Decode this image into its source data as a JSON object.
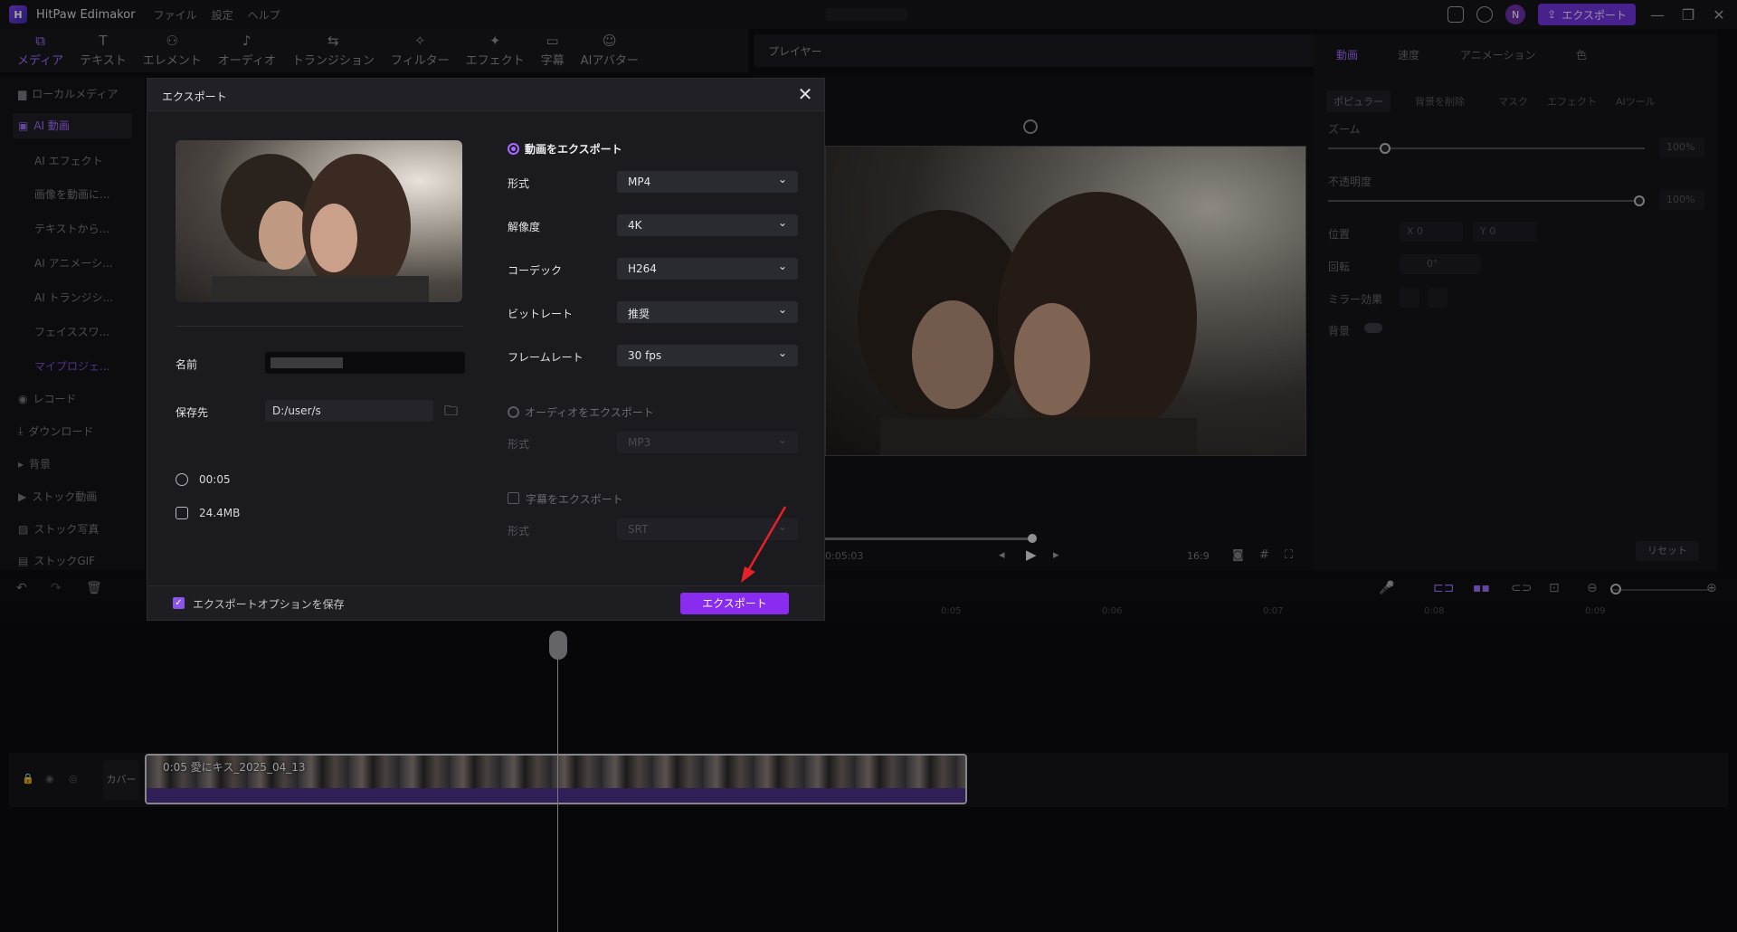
{
  "titlebar": {
    "app_name": "HitPaw Edimakor",
    "menu": [
      "ファイル",
      "設定",
      "ヘルプ"
    ],
    "avatar_letter": "N",
    "export_label": "エクスポート"
  },
  "toolbar": {
    "tools": [
      {
        "label": "メディア",
        "icon": "⧉"
      },
      {
        "label": "テキスト",
        "icon": "T"
      },
      {
        "label": "エレメント",
        "icon": "⚇"
      },
      {
        "label": "オーディオ",
        "icon": "♪"
      },
      {
        "label": "トランジション",
        "icon": "⇆"
      },
      {
        "label": "フィルター",
        "icon": "✧"
      },
      {
        "label": "エフェクト",
        "icon": "✦"
      },
      {
        "label": "字幕",
        "icon": "▭"
      },
      {
        "label": "AIアバター",
        "icon": "☺"
      }
    ]
  },
  "player": {
    "title": "プレイヤー",
    "timecode": "0:05:03",
    "aspect": "16:9"
  },
  "sidebar": {
    "items": [
      {
        "label": "ローカルメディア"
      },
      {
        "label": "AI 動画"
      },
      {
        "label": "AI エフェクト"
      },
      {
        "label": "画像を動画に..."
      },
      {
        "label": "テキストから..."
      },
      {
        "label": "AI アニメーシ..."
      },
      {
        "label": "AI トランジシ..."
      },
      {
        "label": "フェイススワ..."
      },
      {
        "label": "マイプロジェ..."
      },
      {
        "label": "レコード"
      },
      {
        "label": "ダウンロード"
      },
      {
        "label": "背景"
      },
      {
        "label": "ストック動画"
      },
      {
        "label": "ストック写真"
      },
      {
        "label": "ストックGIF"
      }
    ]
  },
  "right_panel": {
    "tabs": [
      "動画",
      "速度",
      "アニメーション",
      "色"
    ],
    "subtabs": [
      "ポピュラー",
      "背景を削除",
      "マスク",
      "エフェクト",
      "AIツール"
    ],
    "zoom_label": "ズーム",
    "zoom_value": "100%",
    "zoom_level": 0.17,
    "opacity_label": "不透明度",
    "opacity_value": "100%",
    "opacity_level": 1.0,
    "position_label": "位置",
    "pos_x": "X  0",
    "pos_y": "Y  0",
    "rotation_label": "回転",
    "rotation_value": "0°",
    "mirror_label": "ミラー効果",
    "background_label": "背景",
    "reset_label": "リセット"
  },
  "timeline": {
    "ruler_ticks": [
      "0:05",
      "0:06",
      "0:07",
      "0:08",
      "0:09"
    ],
    "cover_label": "カバー",
    "clip_title": "0:05 愛にキス_2025_04_13"
  },
  "dialog": {
    "title": "エクスポート",
    "name_label": "名前",
    "save_label": "保存先",
    "save_path": "D:/user/s",
    "duration": "00:05",
    "size": "24.4MB",
    "export_video_label": "動画をエクスポート",
    "video_fields": [
      {
        "label": "形式",
        "value": "MP4"
      },
      {
        "label": "解像度",
        "value": "4K"
      },
      {
        "label": "コーデック",
        "value": "H264"
      },
      {
        "label": "ビットレート",
        "value": "推奨"
      },
      {
        "label": "フレームレート",
        "value": "30  fps"
      }
    ],
    "export_audio_label": "オーディオをエクスポート",
    "audio_format_label": "形式",
    "audio_format_value": "MP3",
    "export_subtitle_label": "字幕をエクスポート",
    "subtitle_format_label": "形式",
    "subtitle_format_value": "SRT",
    "save_options_label": "エクスポートオプションを保存",
    "export_button": "エクスポート"
  },
  "colors": {
    "accent": "#8a2cf0",
    "accent_light": "#a56bff"
  }
}
